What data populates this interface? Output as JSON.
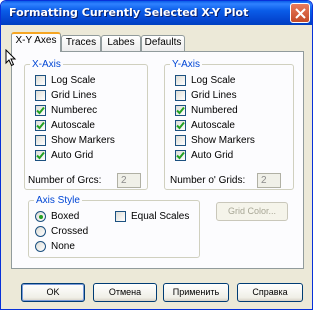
{
  "window": {
    "title": "Formatting Currently Selected X-Y Plot"
  },
  "tabs": [
    {
      "label": "X-Y Axes",
      "active": true
    },
    {
      "label": "Traces",
      "active": false
    },
    {
      "label": "Labes",
      "active": false
    },
    {
      "label": "Defaults",
      "active": false
    }
  ],
  "x_axis": {
    "legend": "X-Axis",
    "options": [
      {
        "label": "Log Scale",
        "checked": false
      },
      {
        "label": "Grid Lines",
        "checked": false
      },
      {
        "label": "Numberec",
        "checked": true
      },
      {
        "label": "Autoscale",
        "checked": true
      },
      {
        "label": "Show Markers",
        "checked": false
      },
      {
        "label": "Auto Grid",
        "checked": true
      }
    ],
    "num_grids_label": "Number of Grcs:",
    "num_grids_value": "2"
  },
  "y_axis": {
    "legend": "Y-Axis",
    "options": [
      {
        "label": "Log Scale",
        "checked": false
      },
      {
        "label": "Grid Lines",
        "checked": false
      },
      {
        "label": "Numbered",
        "checked": true
      },
      {
        "label": "Autoscale",
        "checked": true
      },
      {
        "label": "Show Markers",
        "checked": false
      },
      {
        "label": "Auto Grid",
        "checked": true
      }
    ],
    "num_grids_label": "Number o' Grids:",
    "num_grids_value": "2"
  },
  "axis_style": {
    "legend": "Axis Style",
    "options": [
      {
        "label": "Boxed",
        "selected": true
      },
      {
        "label": "Crossed",
        "selected": false
      },
      {
        "label": "None",
        "selected": false
      }
    ],
    "equal_scales": {
      "label": "Equal Scales",
      "checked": false
    }
  },
  "grid_color_button": "Grid Color...",
  "buttons": {
    "ok": "OK",
    "cancel": "Отмена",
    "apply": "Применить",
    "help": "Справка"
  },
  "colors": {
    "titlebar": "#0a5ce8",
    "legend_text": "#0046d5",
    "checkmark": "#21a121",
    "tab_highlight": "#f6a623"
  }
}
